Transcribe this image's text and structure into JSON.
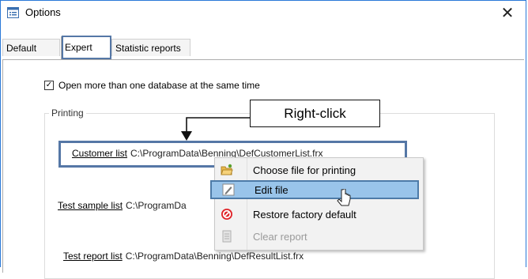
{
  "window": {
    "title": "Options",
    "close_glyph": "✕"
  },
  "tabs": [
    {
      "label": "Default",
      "selected": false
    },
    {
      "label": "Expert",
      "selected": true
    },
    {
      "label": "Statistic reports",
      "selected": false
    }
  ],
  "options": {
    "open_multiple_db": {
      "label": "Open more than one database at the same time",
      "checked": true,
      "check_glyph": "✓"
    }
  },
  "printing": {
    "legend": "Printing",
    "rows": [
      {
        "link": "Customer list",
        "path": "C:\\ProgramData\\Benning\\DefCustomerList.frx"
      },
      {
        "link": "Test sample list",
        "path": "C:\\ProgramDa"
      },
      {
        "link": "Test report list",
        "path": "C:\\ProgramData\\Benning\\DefResultList.frx"
      }
    ]
  },
  "callout": {
    "text": "Right-click"
  },
  "context_menu": {
    "items": [
      {
        "label": "Choose file for printing",
        "icon": "folder-open-icon",
        "state": "normal"
      },
      {
        "label": "Edit file",
        "icon": "pencil-icon",
        "state": "selected"
      },
      {
        "label": "Restore factory default",
        "icon": "no-entry-icon",
        "state": "normal"
      },
      {
        "label": "Clear report",
        "icon": "document-icon",
        "state": "disabled"
      }
    ]
  },
  "colors": {
    "highlight_border": "#5577a6",
    "menu_selected": "#99c4ea",
    "window_border": "#2b79d8"
  }
}
